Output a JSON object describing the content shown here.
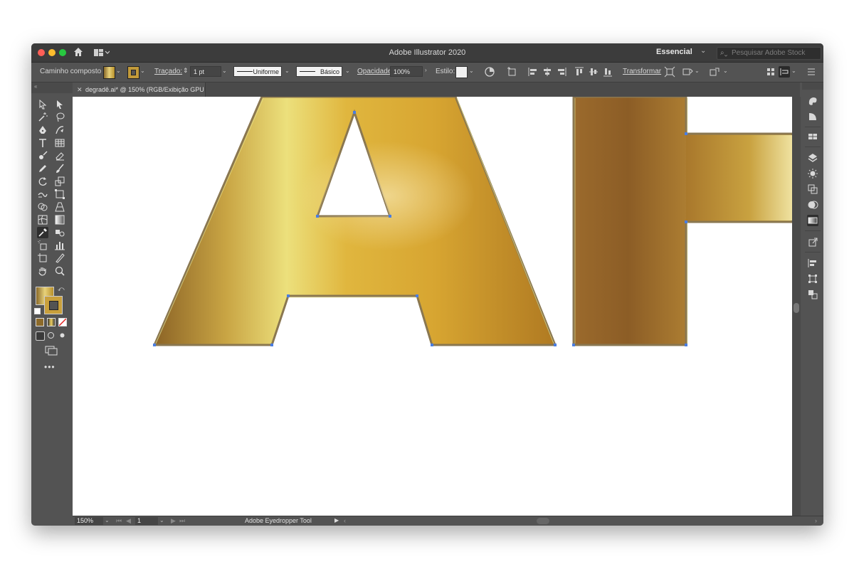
{
  "window": {
    "title": "Adobe Illustrator 2020",
    "workspace": "Essencial",
    "search_placeholder": "Pesquisar Adobe Stock"
  },
  "control_bar": {
    "selection_label": "Caminho composto",
    "stroke_label": "Traçado:",
    "stroke_weight": "1 pt",
    "stroke_profile": "Uniforme",
    "brush_definition": "Básico",
    "opacity_label": "Opacidade:",
    "opacity_value": "100%",
    "style_label": "Estilo:",
    "transform_label": "Transformar"
  },
  "document": {
    "tab_label": "degradê.ai* @ 150% (RGB/Exibição GPU )",
    "artboard_text": "AH"
  },
  "status_bar": {
    "zoom": "150%",
    "artboard_number": "1",
    "current_tool": "Adobe Eyedropper Tool"
  },
  "tools": [
    "selection-tool-icon",
    "direct-selection-tool-icon",
    "magic-wand-tool-icon",
    "lasso-tool-icon",
    "pen-tool-icon",
    "curvature-tool-icon",
    "type-tool-icon",
    "grid-tool-icon",
    "blob-brush-tool-icon",
    "eraser-tool-icon",
    "pencil-tool-icon",
    "paintbrush-tool-icon",
    "rotate-tool-icon",
    "scale-tool-icon",
    "warp-tool-icon",
    "free-transform-tool-icon",
    "shape-builder-tool-icon",
    "perspective-grid-tool-icon",
    "mesh-tool-icon",
    "gradient-tool-icon",
    "eyedropper-tool-icon",
    "blend-tool-icon",
    "symbol-sprayer-tool-icon",
    "column-graph-tool-icon",
    "artboard-tool-icon",
    "slice-tool-icon",
    "hand-tool-icon",
    "zoom-tool-icon"
  ],
  "colors": {
    "ui_panel": "#535353",
    "ui_dark": "#3c3c3c",
    "gold_light": "#e8d878",
    "gold_mid": "#d9a935",
    "gold_dark": "#8c6426",
    "anchor_point": "#4a7de0"
  }
}
